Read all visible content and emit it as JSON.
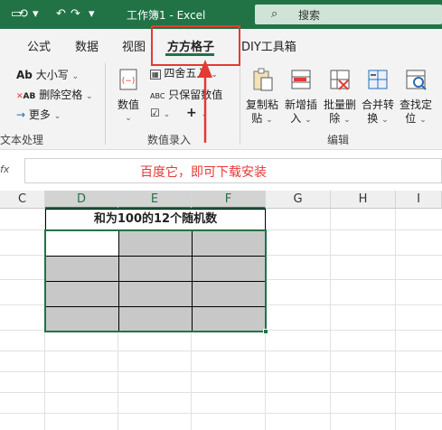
{
  "titlebar": {
    "title": "工作簿1  -  Excel",
    "search_placeholder": "搜索",
    "quick_access": [
      "⟲",
      "▾",
      "↶",
      "↷",
      "▾"
    ]
  },
  "tabs": [
    "公式",
    "数据",
    "视图",
    "方方格子",
    "DIY工具箱"
  ],
  "active_tab": "方方格子",
  "ribbon": {
    "text_group": {
      "label": "文本处理",
      "items": [
        "大小写",
        "删除空格",
        "更多"
      ]
    },
    "numeric_group": {
      "label": "数值录入",
      "big_button": "数值",
      "items": [
        "四舍五入",
        "只保留数值"
      ]
    },
    "edit_group": {
      "label": "编辑",
      "buttons": [
        {
          "l1": "复制粘",
          "l2": "贴"
        },
        {
          "l1": "新增插",
          "l2": "入"
        },
        {
          "l1": "批量删",
          "l2": "除"
        },
        {
          "l1": "合并转",
          "l2": "换"
        },
        {
          "l1": "查找定",
          "l2": "位"
        }
      ]
    }
  },
  "formula_bar": {
    "fx": "fx",
    "value": ""
  },
  "annotation": "百度它，即可下载安装",
  "columns": [
    "C",
    "D",
    "E",
    "F",
    "G",
    "H",
    "I"
  ],
  "sheet": {
    "merged_title": "和为100的12个随机数"
  },
  "colors": {
    "excel_green": "#217346",
    "highlight_red": "#e53935",
    "cell_gray": "#c8c8c8"
  }
}
